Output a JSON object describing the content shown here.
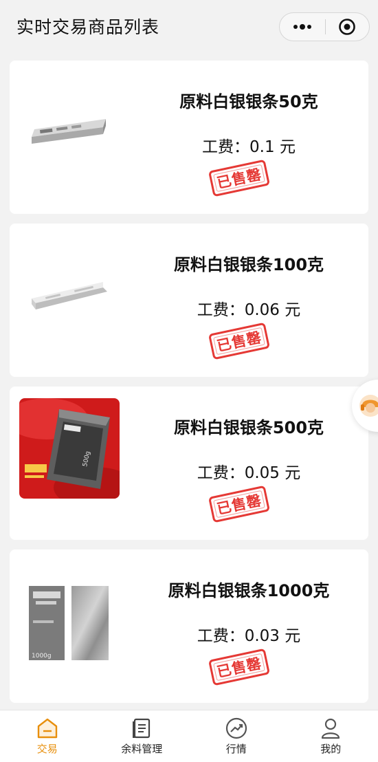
{
  "header": {
    "title": "实时交易商品列表",
    "more_icon": "more-dots-icon",
    "close_icon": "target-close-icon"
  },
  "products": [
    {
      "name": "原料白银银条50克",
      "fee_label": "工费：",
      "fee_value": "0.1",
      "fee_unit": "元",
      "status": "已售罄",
      "image": "silver-bar-50g"
    },
    {
      "name": "原料白银银条100克",
      "fee_label": "工费：",
      "fee_value": "0.06",
      "fee_unit": "元",
      "status": "已售罄",
      "image": "silver-bar-100g"
    },
    {
      "name": "原料白银银条500克",
      "fee_label": "工费：",
      "fee_value": "0.05",
      "fee_unit": "元",
      "status": "已售罄",
      "image": "silver-bar-500g"
    },
    {
      "name": "原料白银银条1000克",
      "fee_label": "工费：",
      "fee_value": "0.03",
      "fee_unit": "元",
      "status": "已售罄",
      "image": "silver-bar-1000g"
    }
  ],
  "product_images": {
    "500g_bar_text": "500g",
    "1000g_bar_text": "1000g"
  },
  "tabbar": {
    "items": [
      {
        "label": "交易",
        "icon": "trade-home-icon",
        "active": true
      },
      {
        "label": "余料管理",
        "icon": "document-list-icon",
        "active": false
      },
      {
        "label": "行情",
        "icon": "trend-chart-icon",
        "active": false
      },
      {
        "label": "我的",
        "icon": "user-icon",
        "active": false
      }
    ]
  },
  "colors": {
    "accent": "#e88f0c",
    "stamp_red": "#e53935",
    "background": "#f2f2f2"
  }
}
